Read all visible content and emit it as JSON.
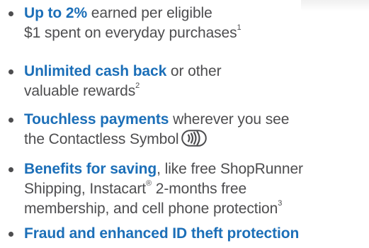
{
  "items": [
    {
      "highlight": "Up to 2%",
      "text_1": " earned per eligible",
      "text_2": "$1 spent on everyday purchases",
      "footnote": "1"
    },
    {
      "highlight": "Unlimited cash back",
      "text_1": " or other",
      "text_2": "valuable rewards",
      "footnote": "2"
    },
    {
      "highlight": "Touchless payments",
      "text_1": " wherever you see",
      "text_2": "the Contactless Symbol",
      "icon": "contactless-symbol-icon"
    },
    {
      "highlight": "Benefits for saving",
      "text_1": ", like free ShopRunner",
      "text_2a": "Shipping, Instacart",
      "registered": "®",
      "text_2b": " 2-months free",
      "text_3": "membership, and cell phone protection",
      "footnote": "3"
    },
    {
      "highlight": "Fraud and enhanced ID theft protection"
    }
  ],
  "colors": {
    "highlight": "#1c6fb8",
    "body_text": "#4d4d4f"
  }
}
